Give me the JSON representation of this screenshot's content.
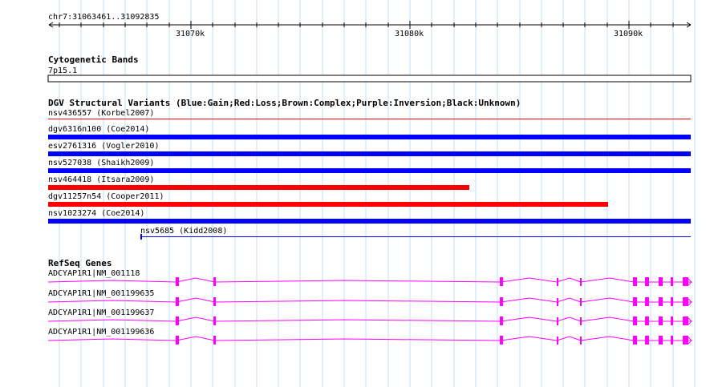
{
  "ruler": {
    "range_label": "chr7:31063461..31092835",
    "ticks": [
      "31070k",
      "31080k",
      "31090k"
    ]
  },
  "tracks": {
    "cytoband": {
      "title": "Cytogenetic Bands",
      "band": "7p15.1"
    },
    "dgv": {
      "title": "DGV Structural Variants (Blue:Gain;Red:Loss;Brown:Complex;Purple:Inversion;Black:Unknown)",
      "features": [
        {
          "label": "nsv436557 (Korbel2007)",
          "color": "#ff0000",
          "style": "thin"
        },
        {
          "label": "dgv6316n100 (Coe2014)",
          "color": "#0000ff",
          "style": "thick"
        },
        {
          "label": "esv2761316 (Vogler2010)",
          "color": "#0000ff",
          "style": "thick"
        },
        {
          "label": "nsv527038 (Shaikh2009)",
          "color": "#0000ff",
          "style": "thick"
        },
        {
          "label": "nsv464418 (Itsara2009)",
          "color": "#ff0000",
          "style": "thick"
        },
        {
          "label": "dgv11257n54 (Cooper2011)",
          "color": "#ff0000",
          "style": "thick"
        },
        {
          "label": "nsv1023274 (Coe2014)",
          "color": "#0000ff",
          "style": "thick"
        },
        {
          "label": "nsv5685 (Kidd2008)",
          "color": "#0000ff",
          "style": "thin"
        }
      ]
    },
    "refseq": {
      "title": "RefSeq Genes",
      "color": "#ff00ff",
      "transcripts": [
        {
          "label": "ADCYAP1R1|NM_001118"
        },
        {
          "label": "ADCYAP1R1|NM_001199635"
        },
        {
          "label": "ADCYAP1R1|NM_001199637"
        },
        {
          "label": "ADCYAP1R1|NM_001199636"
        }
      ]
    }
  },
  "colors": {
    "grid": "#c6def0",
    "gain": "#0000ff",
    "loss": "#ff0000",
    "gene": "#ff00ff"
  }
}
